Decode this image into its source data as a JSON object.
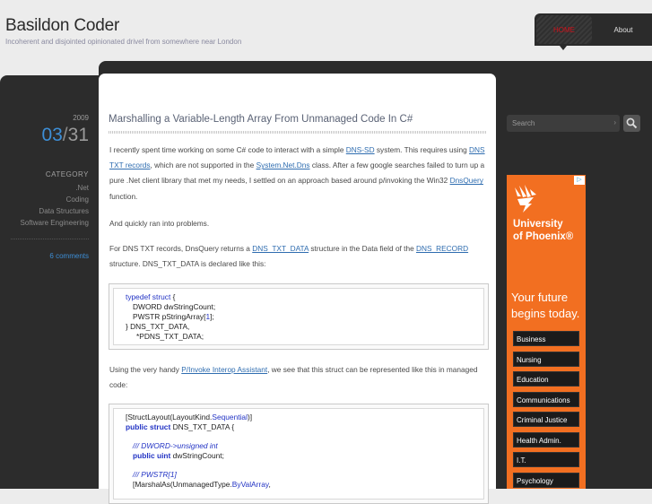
{
  "site": {
    "title": "Basildon Coder",
    "tagline": "Incoherent and disjointed opinionated drivel from somewhere near London"
  },
  "nav": {
    "home": "HOME",
    "about": "About"
  },
  "post": {
    "year": "2009",
    "month": "03",
    "day": "31",
    "category_heading": "CATEGORY",
    "categories": [
      ".Net",
      "Coding",
      "Data Structures",
      "Software Engineering"
    ],
    "comments": "6 comments",
    "title": "Marshalling a Variable-Length Array From Unmanaged Code In C#",
    "p1": {
      "t1": "I recently spent time working on some C# code to interact with a simple ",
      "l1": "DNS-SD",
      "t2": " system. This requires using ",
      "l2": "DNS TXT records",
      "t3": ", which are not supported in the ",
      "l3": "System.Net.Dns",
      "t4": " class. After a few google searches failed to turn up a pure .Net client library that met my needs, I settled on an approach based around p/invoking the Win32 ",
      "l4": "DnsQuery",
      "t5": " function."
    },
    "p2": "And quickly ran into problems.",
    "p3": {
      "t1": "For DNS TXT records, DnsQuery returns a ",
      "l1": "DNS_TXT_DATA",
      "t2": " structure in the Data field of the ",
      "l2": "DNS_RECORD",
      "t3": " structure. DNS_TXT_DATA is declared like this:"
    },
    "code1": {
      "l1_kw": "typedef struct",
      "l1_br": " {",
      "l2": "DWORD dwStringCount;",
      "l3_a": "PWSTR pStringArray[",
      "l3_n": "1",
      "l3_b": "];",
      "l4": "} DNS_TXT_DATA,",
      "l5": "*PDNS_TXT_DATA;"
    },
    "p4": {
      "t1": "Using the very handy ",
      "l1": "P/Invoke Interop Assistant",
      "t2": ", we see that this struct can be represented like this in managed code:"
    },
    "code2": {
      "l1_a": "[StructLayout(LayoutKind.",
      "l1_kw": "Sequential",
      "l1_b": ")]",
      "l2_kw": "public struct",
      "l2_rest": " DNS_TXT_DATA {",
      "l3": "/// DWORD->unsigned int",
      "l4_kw": "public uint",
      "l4_rest": " dwStringCount;",
      "l5": "/// PWSTR[1]",
      "l6_a": "[MarshalAs(UnmanagedType.",
      "l6_kw": "ByValArray",
      "l6_b": ","
    }
  },
  "search": {
    "placeholder": "Search"
  },
  "ad": {
    "uni_line1": "University",
    "uni_line2": "of Phoenix®",
    "tag_line1": "Your future",
    "tag_line2": "begins today.",
    "buttons": [
      "Business",
      "Nursing",
      "Education",
      "Communications",
      "Criminal Justice",
      "Health Admin.",
      "I.T.",
      "Psychology"
    ],
    "badge_color": "#3da0d8",
    "bg_color": "#f26f21"
  },
  "colors": {
    "accent": "#3d8ed6",
    "link": "#2f6db0",
    "home_active": "#d0111a",
    "dark": "#2b2b2b"
  }
}
